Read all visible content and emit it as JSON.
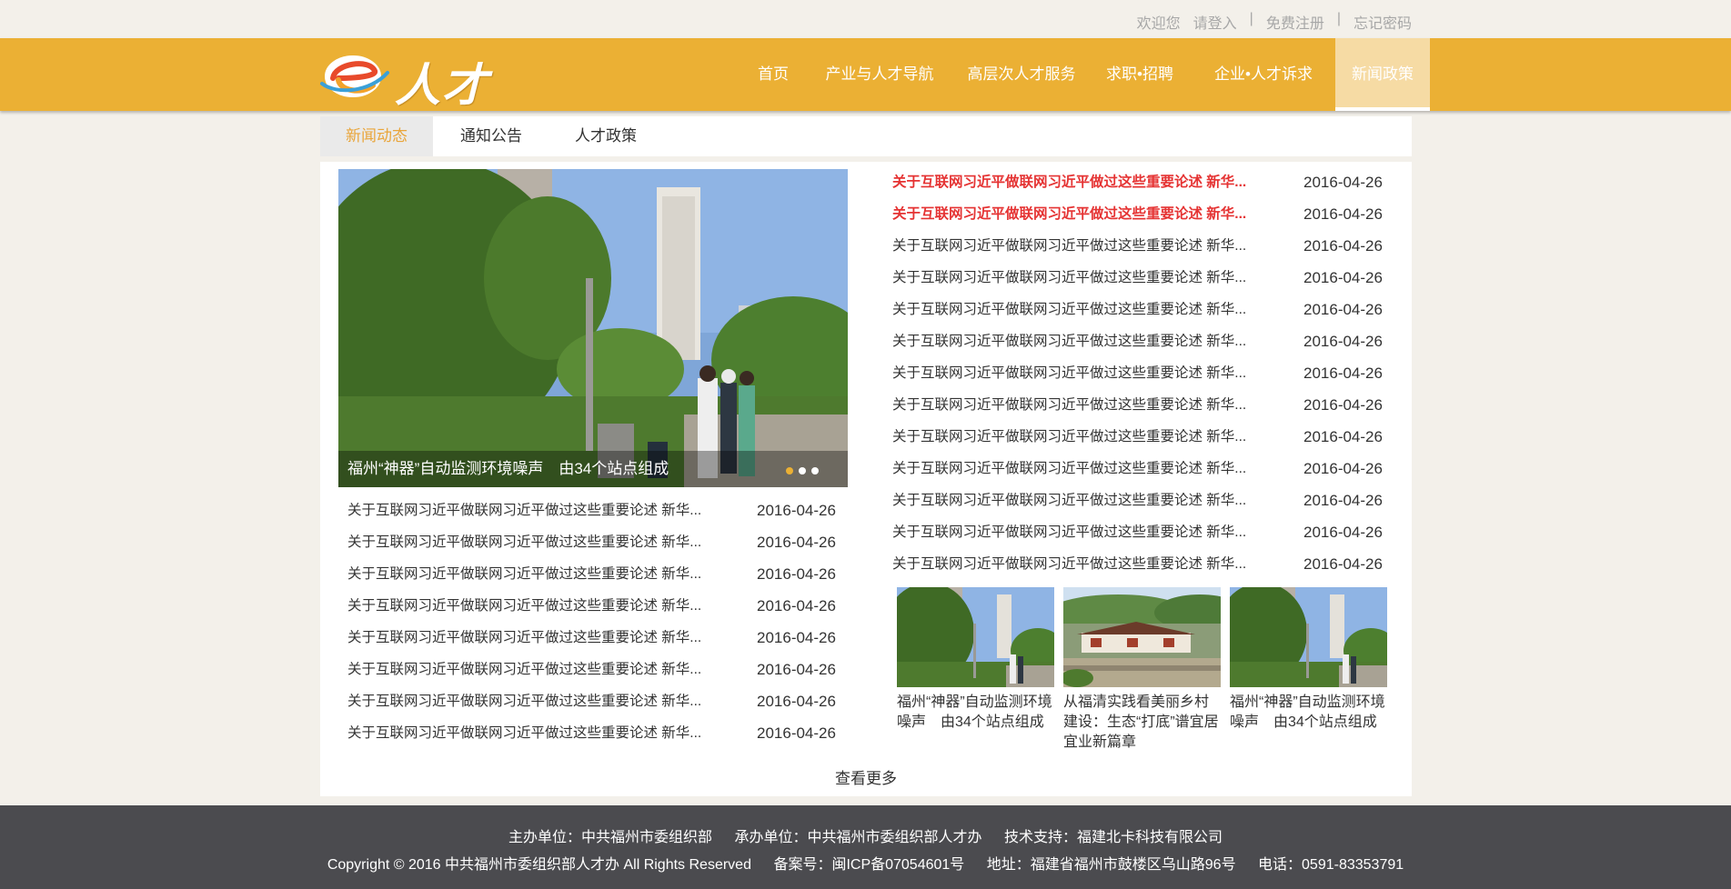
{
  "topbar": {
    "welcome": "欢迎您",
    "login": "请登入",
    "separator": "|",
    "register": "免费注册",
    "forgot_password": "忘记密码"
  },
  "header": {
    "logo_text": "人才",
    "brand_color": "#ebb034",
    "nav": [
      {
        "label": "首页",
        "active": false
      },
      {
        "label": "产业与人才导航",
        "active": false
      },
      {
        "label": "高层次人才服务",
        "active": false
      },
      {
        "label": "求职•招聘",
        "active": false
      },
      {
        "label": "企业•人才诉求",
        "active": false
      },
      {
        "label": "新闻政策",
        "active": true
      }
    ]
  },
  "tabs": [
    {
      "label": "新闻动态",
      "active": true
    },
    {
      "label": "通知公告",
      "active": false
    },
    {
      "label": "人才政策",
      "active": false
    }
  ],
  "featured": {
    "caption": "福州“神器”自动监测环境噪声　由34个站点组成",
    "slide_count": 3,
    "active_slide": 1
  },
  "left_news": [
    {
      "title": "关于互联网习近平做联网习近平做过这些重要论述 新华...",
      "date": "2016-04-26"
    },
    {
      "title": "关于互联网习近平做联网习近平做过这些重要论述 新华...",
      "date": "2016-04-26"
    },
    {
      "title": "关于互联网习近平做联网习近平做过这些重要论述 新华...",
      "date": "2016-04-26"
    },
    {
      "title": "关于互联网习近平做联网习近平做过这些重要论述 新华...",
      "date": "2016-04-26"
    },
    {
      "title": "关于互联网习近平做联网习近平做过这些重要论述 新华...",
      "date": "2016-04-26"
    },
    {
      "title": "关于互联网习近平做联网习近平做过这些重要论述 新华...",
      "date": "2016-04-26"
    },
    {
      "title": "关于互联网习近平做联网习近平做过这些重要论述 新华...",
      "date": "2016-04-26"
    },
    {
      "title": "关于互联网习近平做联网习近平做过这些重要论述 新华...",
      "date": "2016-04-26"
    }
  ],
  "right_news": [
    {
      "title": "关于互联网习近平做联网习近平做过这些重要论述 新华...",
      "date": "2016-04-26",
      "hot": true
    },
    {
      "title": "关于互联网习近平做联网习近平做过这些重要论述 新华...",
      "date": "2016-04-26",
      "hot": true
    },
    {
      "title": "关于互联网习近平做联网习近平做过这些重要论述 新华...",
      "date": "2016-04-26",
      "hot": false
    },
    {
      "title": "关于互联网习近平做联网习近平做过这些重要论述 新华...",
      "date": "2016-04-26",
      "hot": false
    },
    {
      "title": "关于互联网习近平做联网习近平做过这些重要论述 新华...",
      "date": "2016-04-26",
      "hot": false
    },
    {
      "title": "关于互联网习近平做联网习近平做过这些重要论述 新华...",
      "date": "2016-04-26",
      "hot": false
    },
    {
      "title": "关于互联网习近平做联网习近平做过这些重要论述 新华...",
      "date": "2016-04-26",
      "hot": false
    },
    {
      "title": "关于互联网习近平做联网习近平做过这些重要论述 新华...",
      "date": "2016-04-26",
      "hot": false
    },
    {
      "title": "关于互联网习近平做联网习近平做过这些重要论述 新华...",
      "date": "2016-04-26",
      "hot": false
    },
    {
      "title": "关于互联网习近平做联网习近平做过这些重要论述 新华...",
      "date": "2016-04-26",
      "hot": false
    },
    {
      "title": "关于互联网习近平做联网习近平做过这些重要论述 新华...",
      "date": "2016-04-26",
      "hot": false
    },
    {
      "title": "关于互联网习近平做联网习近平做过这些重要论述 新华...",
      "date": "2016-04-26",
      "hot": false
    },
    {
      "title": "关于互联网习近平做联网习近平做过这些重要论述 新华...",
      "date": "2016-04-26",
      "hot": false
    }
  ],
  "thumbnails": [
    {
      "caption": "福州“神器”自动监测环境噪声　由34个站点组成",
      "scene": "city-park"
    },
    {
      "caption": "从福清实践看美丽乡村建设：生态“打底”谱宜居宜业新篇章",
      "scene": "village"
    },
    {
      "caption": "福州“神器”自动监测环境噪声　由34个站点组成",
      "scene": "city-park"
    }
  ],
  "more_label": "查看更多",
  "footer": {
    "sponsor": "主办单位：中共福州市委组织部",
    "organizer": "承办单位：中共福州市委组织部人才办",
    "tech_support": "技术支持：福建北卡科技有限公司",
    "copyright": "Copyright © 2016 中共福州市委组织部人才办 All Rights Reserved",
    "icp": "备案号：闽ICP备07054601号",
    "address": "地址：福建省福州市鼓楼区乌山路96号",
    "phone": "电话：0591-83353791"
  }
}
